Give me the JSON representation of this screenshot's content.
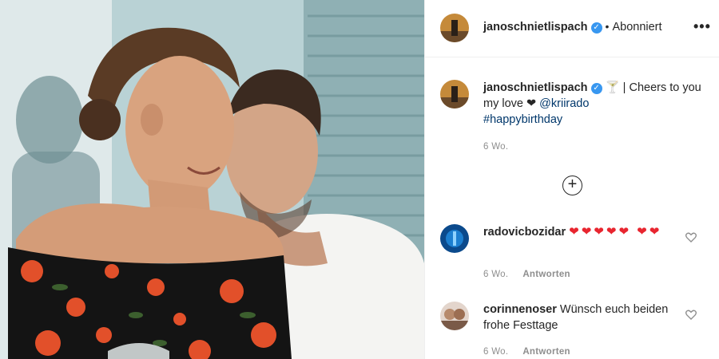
{
  "header": {
    "username": "janoschnietlispach",
    "separator": "•",
    "follow_status": "Abonniert",
    "more_icon": "•••"
  },
  "caption": {
    "username": "janoschnietlispach",
    "emoji": "🍸",
    "text": "| Cheers to you my love ❤",
    "mention": "@kriirado",
    "hashtag": "#happybirthday",
    "time": "6 Wo."
  },
  "load_more_icon": "+",
  "comments": [
    {
      "username": "radovicbozidar",
      "text": "❤❤❤❤❤ ❤❤",
      "time": "6 Wo.",
      "reply_label": "Antworten"
    },
    {
      "username": "corinnenoser",
      "text": "Wünsch euch beiden frohe Festtage",
      "time": "6 Wo.",
      "reply_label": "Antworten"
    }
  ],
  "colors": {
    "verified": "#3897f0",
    "link": "#00376b",
    "muted": "#8e8e8e",
    "heart": "#e8252f"
  }
}
